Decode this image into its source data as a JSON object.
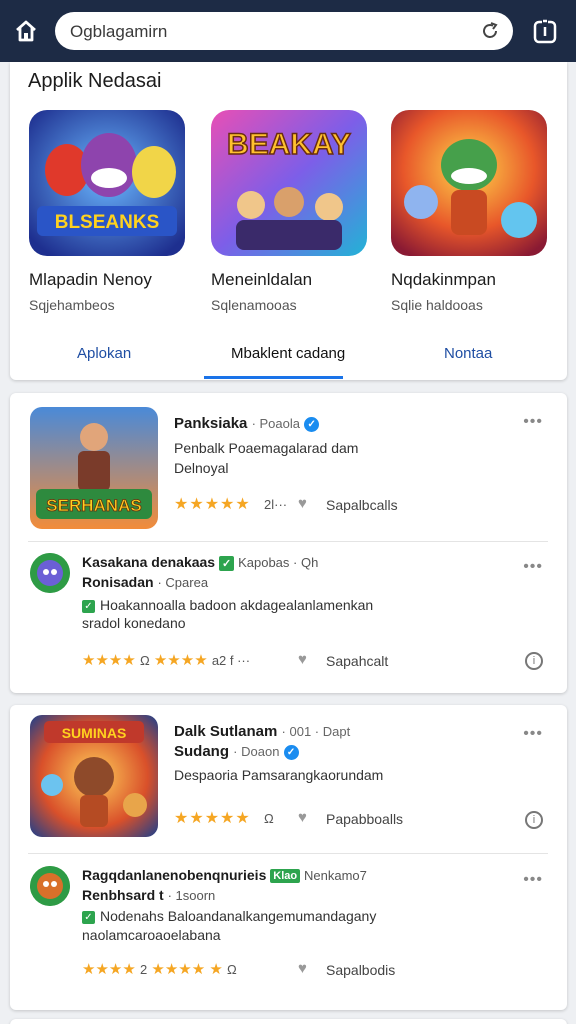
{
  "browser": {
    "url_text": "Ogblagamirn"
  },
  "section": {
    "title": "Applik Nedasai"
  },
  "apps": [
    {
      "name": "Mlapadin Nenoy",
      "subtitle": "Sqjehambeos",
      "icon_text": "BLSEANKS"
    },
    {
      "name": "Meneinldalan",
      "subtitle": "Sqlenamooas",
      "icon_text": "BEAKAY"
    },
    {
      "name": "Nqdakinmpan",
      "subtitle": "Sqlie haldooas",
      "icon_text": ""
    }
  ],
  "tabs": [
    {
      "label": "Aplokan"
    },
    {
      "label": "Mbaklent cadang"
    },
    {
      "label": "Nontaa"
    }
  ],
  "posts": [
    {
      "title": "Panksiaka",
      "meta": "· Poaola",
      "line1": "Penbalk Poaemagalarad dam",
      "line2": "Delnoyal",
      "rating_count": "2l···",
      "share_label": "Sapalbcalls",
      "thumb_text": "SERHANAS",
      "comment": {
        "title": "Kasakana denakaas",
        "badge": "✓",
        "meta": "Kapobas · Qh",
        "title2": "Ronisadan",
        "meta2": "· Cparea",
        "line1": "Hoakannoalla badoon akdagealanlamenkan",
        "line2": "sradol konedano",
        "rating_a": "Ω",
        "rating_count": "a2 f ···",
        "share_label": "Sapahcalt"
      }
    },
    {
      "title": "Dalk Sutlanam",
      "meta": "· 001 · Dapt",
      "title2": "Sudang",
      "meta2": "· Doaon",
      "line1": "Despaoria Pamsarangkaorundam",
      "rating_count": "Ω",
      "share_label": "Papabboalls",
      "thumb_text": "SUMINAS",
      "comment": {
        "title": "Ragqdanlanenobenqnurieis",
        "badge": "Klao",
        "meta": "Nenkamo7",
        "title2": "Renbhsard t",
        "meta2": "· 1soorn",
        "line1": "Nodenahs Baloandanalkangemumandagany",
        "line2": "naolamcaroaoelabana",
        "rating_a": "2",
        "rating_count": "Ω",
        "share_label": "Sapalbodis"
      }
    }
  ],
  "colors": {
    "topbar": "#1d2b45",
    "accent": "#1a73e8",
    "star": "#f5a623",
    "badge": "#2da44e"
  }
}
